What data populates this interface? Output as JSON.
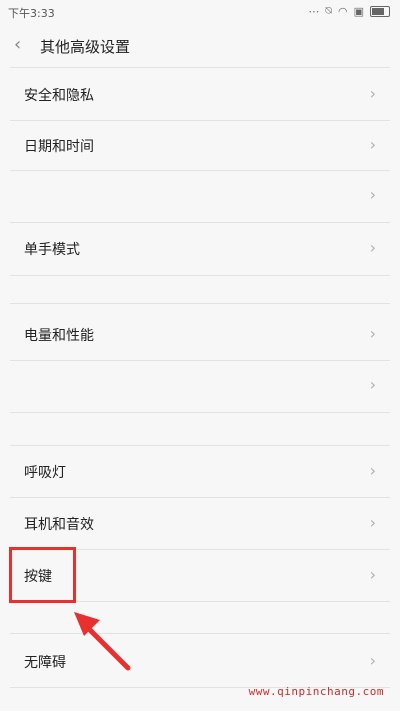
{
  "status_bar": {
    "time": "下午3:33",
    "icons": [
      "signal-icon",
      "mute-icon",
      "wifi-icon",
      "sim-icon",
      "battery-icon"
    ]
  },
  "header": {
    "title": "其他高级设置"
  },
  "rows": [
    {
      "label": "安全和隐私"
    },
    {
      "label": "日期和时间"
    },
    {
      "label": ""
    },
    {
      "label": "单手模式"
    },
    {
      "label": "电量和性能"
    },
    {
      "label": ""
    },
    {
      "label": "呼吸灯"
    },
    {
      "label": "耳机和音效"
    },
    {
      "label": "按键"
    },
    {
      "label": "无障碍"
    }
  ],
  "watermark": "www.qinpinchang.com",
  "colors": {
    "accent": "#e8302f",
    "background": "#f7f7f7",
    "chevron": "#b0b0b0"
  }
}
